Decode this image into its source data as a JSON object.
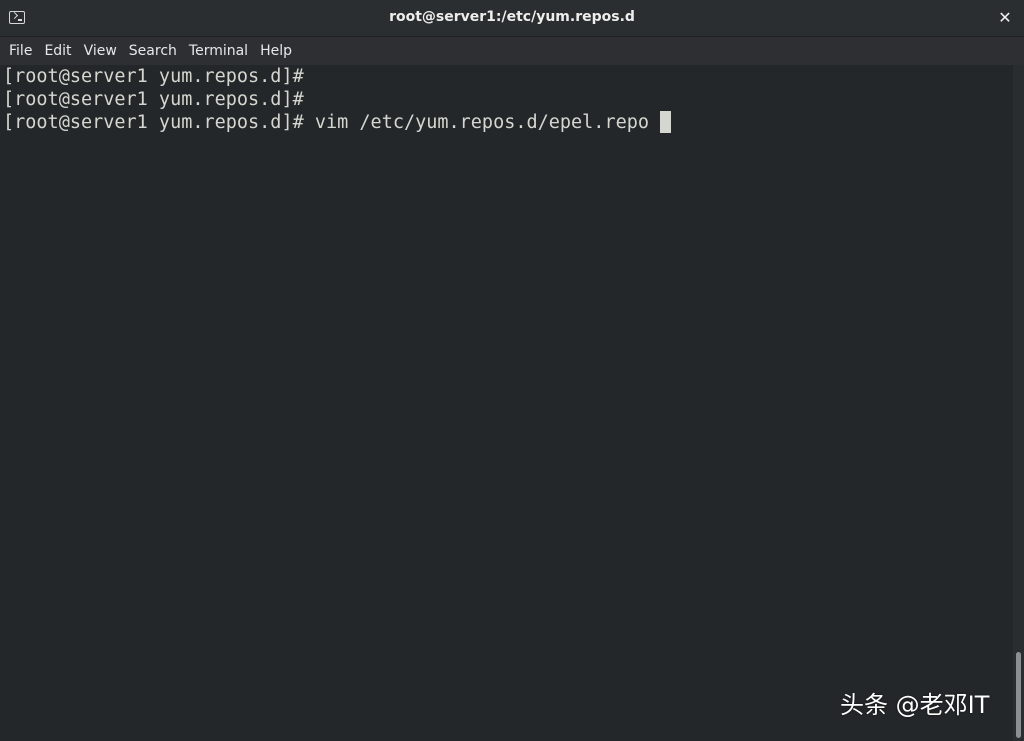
{
  "window": {
    "title": "root@server1:/etc/yum.repos.d",
    "close_label": "✕"
  },
  "menu": {
    "items": [
      "File",
      "Edit",
      "View",
      "Search",
      "Terminal",
      "Help"
    ]
  },
  "terminal": {
    "lines": [
      "[root@server1 yum.repos.d]#",
      "[root@server1 yum.repos.d]#",
      "[root@server1 yum.repos.d]# vim /etc/yum.repos.d/epel.repo"
    ]
  },
  "watermark": {
    "text": "头条 @老邓IT"
  },
  "colors": {
    "terminal_bg": "#232729",
    "terminal_fg": "#d3d7cf",
    "titlebar_bg": "#2b2e31"
  }
}
